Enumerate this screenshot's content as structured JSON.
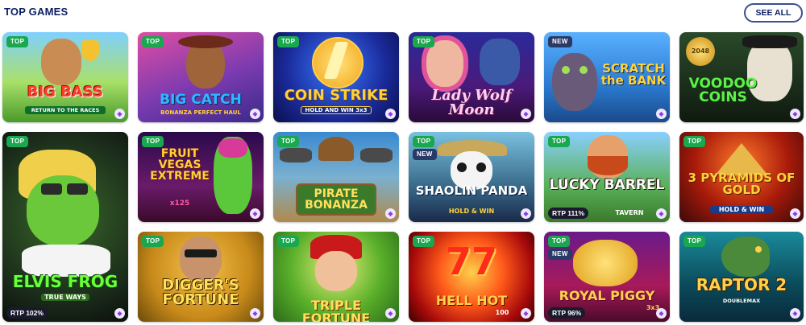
{
  "section": {
    "title": "TOP GAMES",
    "see_all": "SEE ALL"
  },
  "colors": {
    "top_badge": "#19a84f",
    "new_badge": "#2a3a66",
    "title": "#0b1e63"
  },
  "games": [
    {
      "logo": "BIG BASS",
      "sub": "RETURN TO THE RACES",
      "badge": "TOP",
      "rtp": ""
    },
    {
      "logo": "BIG CATCH",
      "sub": "BONANZA PERFECT HAUL",
      "badge": "TOP",
      "rtp": ""
    },
    {
      "logo": "COIN STRIKE",
      "sub": "HOLD AND WIN 3x3",
      "badge": "TOP",
      "rtp": ""
    },
    {
      "logo": "Lady Wolf Moon",
      "sub": "",
      "badge": "TOP",
      "rtp": ""
    },
    {
      "logo": "SCRATCH the BANK",
      "sub": "",
      "badge": "NEW",
      "rtp": ""
    },
    {
      "logo": "VOODOO COINS",
      "sub": "2048",
      "badge": "TOP",
      "rtp": ""
    },
    {
      "logo": "ELVIS FROG",
      "sub": "TRUE WAYS",
      "badge": "TOP",
      "rtp": "RTP 102%"
    },
    {
      "logo": "FRUIT VEGAS EXTREME",
      "sub": "x125",
      "badge": "TOP",
      "rtp": ""
    },
    {
      "logo": "PIRATE BONANZA",
      "sub": "",
      "badge": "TOP",
      "rtp": ""
    },
    {
      "logo": "SHAOLIN PANDA",
      "sub": "HOLD & WIN",
      "badge": "NEW",
      "badge2": "TOP",
      "rtp": ""
    },
    {
      "logo": "LUCKY BARREL",
      "sub": "TAVERN",
      "badge": "TOP",
      "rtp": "RTP 111%"
    },
    {
      "logo": "3 PYRAMIDS OF GOLD",
      "sub": "HOLD & WIN",
      "badge": "TOP",
      "rtp": ""
    },
    {
      "logo": "DIGGER'S FORTUNE",
      "sub": "",
      "badge": "TOP",
      "rtp": ""
    },
    {
      "logo": "TRIPLE FORTUNE",
      "sub": "",
      "badge": "TOP",
      "rtp": ""
    },
    {
      "logo": "HELL HOT",
      "sub": "100",
      "badge": "TOP",
      "rtp": ""
    },
    {
      "logo": "ROYAL PIGGY",
      "sub": "3x3",
      "badge": "NEW",
      "badge2": "TOP",
      "rtp": "RTP 96%"
    },
    {
      "logo": "RAPTOR 2",
      "sub": "DOUBLEMAX",
      "badge": "TOP",
      "rtp": ""
    }
  ]
}
